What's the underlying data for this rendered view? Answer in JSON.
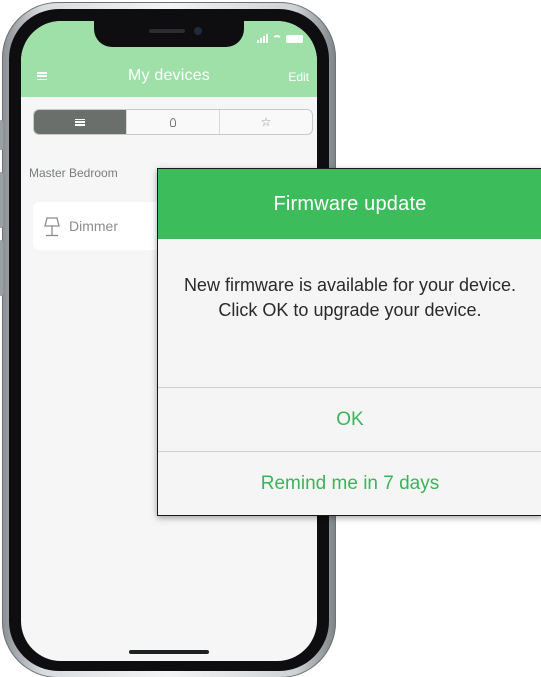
{
  "app": {
    "title": "My devices",
    "edit_label": "Edit"
  },
  "tabs": [
    {
      "icon": "list-icon",
      "selected": true
    },
    {
      "icon": "bulb-icon",
      "selected": false
    },
    {
      "icon": "star-icon",
      "selected": false
    }
  ],
  "room": {
    "name": "Master Bedroom",
    "devices": [
      {
        "name": "Dimmer",
        "icon": "lamp-icon"
      }
    ]
  },
  "dialog": {
    "title": "Firmware update",
    "message": "New firmware is available for your device. Click OK to upgrade your device.",
    "ok_label": "OK",
    "remind_label": "Remind me in 7 days"
  },
  "colors": {
    "header_green": "#9fe0a8",
    "dialog_green": "#3dbc5c",
    "button_text_green": "#3cb45a"
  }
}
